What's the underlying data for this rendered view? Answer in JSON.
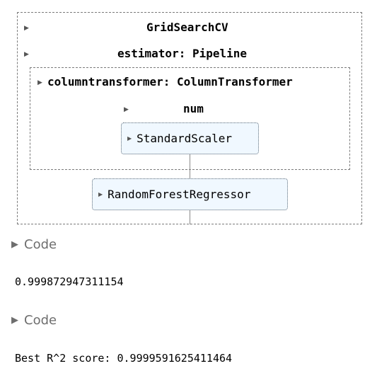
{
  "pipeline_diagram": {
    "grid_search_label": "GridSearchCV",
    "estimator_label": "estimator: Pipeline",
    "column_transformer_label": "columntransformer: ColumnTransformer",
    "num_label": "num",
    "scaler_label": "StandardScaler",
    "regressor_label": "RandomForestRegressor"
  },
  "cells": [
    {
      "toggle_label": "Code",
      "output": "0.999872947311154"
    },
    {
      "toggle_label": "Code",
      "output": "Best R^2 score: 0.9999591625411464"
    }
  ],
  "icons": {
    "collapsed_triangle": "triangle-right-icon"
  }
}
